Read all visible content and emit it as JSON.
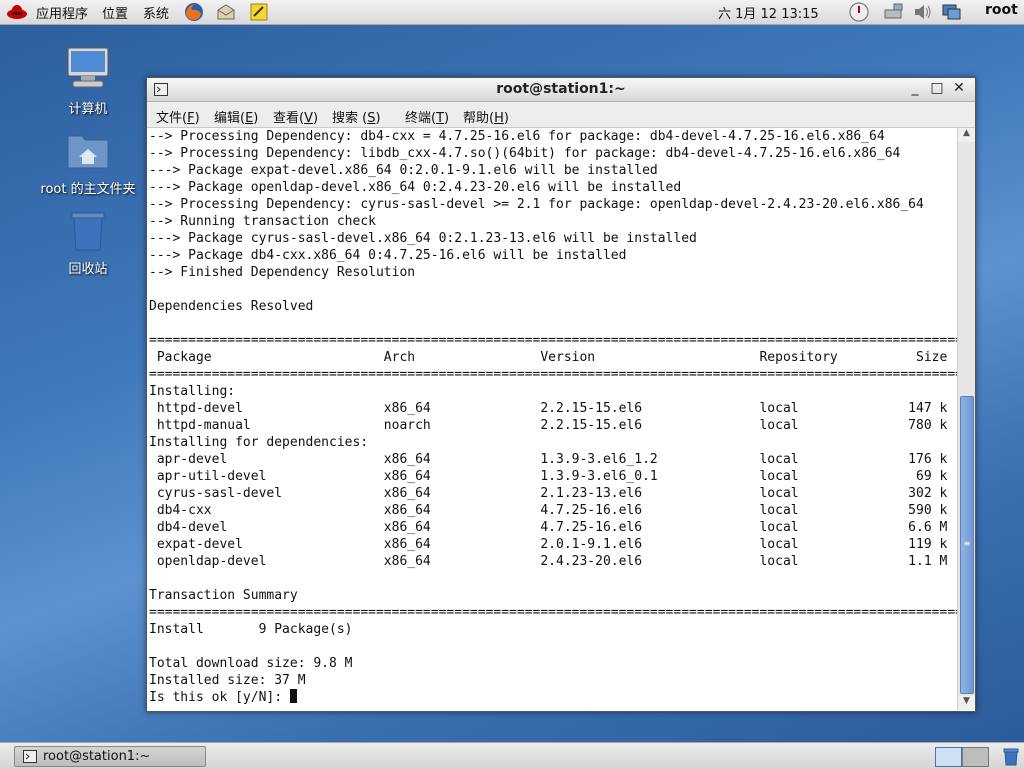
{
  "top_panel": {
    "menu_applications": "应用程序",
    "menu_places": "位置",
    "menu_system": "系统",
    "clock": "六 1月 12 13:15",
    "user": "root"
  },
  "desktop": {
    "icons": [
      {
        "label": "计算机"
      },
      {
        "label": "root 的主文件夹"
      },
      {
        "label": "回收站"
      }
    ]
  },
  "window": {
    "title": "root@station1:~",
    "menus": [
      "文件(F)",
      "编辑(E)",
      "查看(V)",
      "搜索 (S)",
      "终端(T)",
      "帮助(H)"
    ],
    "menu_parts": [
      {
        "text": "文件(",
        "key": "F",
        "end": ")"
      },
      {
        "text": "编辑(",
        "key": "E",
        "end": ")"
      },
      {
        "text": "查看(",
        "key": "V",
        "end": ")"
      },
      {
        "text": "搜索 (",
        "key": "S",
        "end": ")"
      },
      {
        "text": "终端(",
        "key": "T",
        "end": ")"
      },
      {
        "text": "帮助(",
        "key": "H",
        "end": ")"
      }
    ]
  },
  "terminal": {
    "lines": [
      "--> Processing Dependency: db4-cxx = 4.7.25-16.el6 for package: db4-devel-4.7.25-16.el6.x86_64",
      "--> Processing Dependency: libdb_cxx-4.7.so()(64bit) for package: db4-devel-4.7.25-16.el6.x86_64",
      "---> Package expat-devel.x86_64 0:2.0.1-9.1.el6 will be installed",
      "---> Package openldap-devel.x86_64 0:2.4.23-20.el6 will be installed",
      "--> Processing Dependency: cyrus-sasl-devel >= 2.1 for package: openldap-devel-2.4.23-20.el6.x86_64",
      "--> Running transaction check",
      "---> Package cyrus-sasl-devel.x86_64 0:2.1.23-13.el6 will be installed",
      "---> Package db4-cxx.x86_64 0:4.7.25-16.el6 will be installed",
      "--> Finished Dependency Resolution",
      "",
      "Dependencies Resolved",
      "",
      "=========================================================================================================",
      " Package                      Arch                Version                     Repository          Size",
      "=========================================================================================================",
      "Installing:",
      " httpd-devel                  x86_64              2.2.15-15.el6               local              147 k",
      " httpd-manual                 noarch              2.2.15-15.el6               local              780 k",
      "Installing for dependencies:",
      " apr-devel                    x86_64              1.3.9-3.el6_1.2             local              176 k",
      " apr-util-devel               x86_64              1.3.9-3.el6_0.1             local               69 k",
      " cyrus-sasl-devel             x86_64              2.1.23-13.el6               local              302 k",
      " db4-cxx                      x86_64              4.7.25-16.el6               local              590 k",
      " db4-devel                    x86_64              4.7.25-16.el6               local              6.6 M",
      " expat-devel                  x86_64              2.0.1-9.1.el6               local              119 k",
      " openldap-devel               x86_64              2.4.23-20.el6               local              1.1 M",
      "",
      "Transaction Summary",
      "=========================================================================================================",
      "Install       9 Package(s)",
      "",
      "Total download size: 9.8 M",
      "Installed size: 37 M",
      "Is this ok [y/N]: "
    ]
  },
  "taskbar": {
    "task_label": "root@station1:~"
  }
}
